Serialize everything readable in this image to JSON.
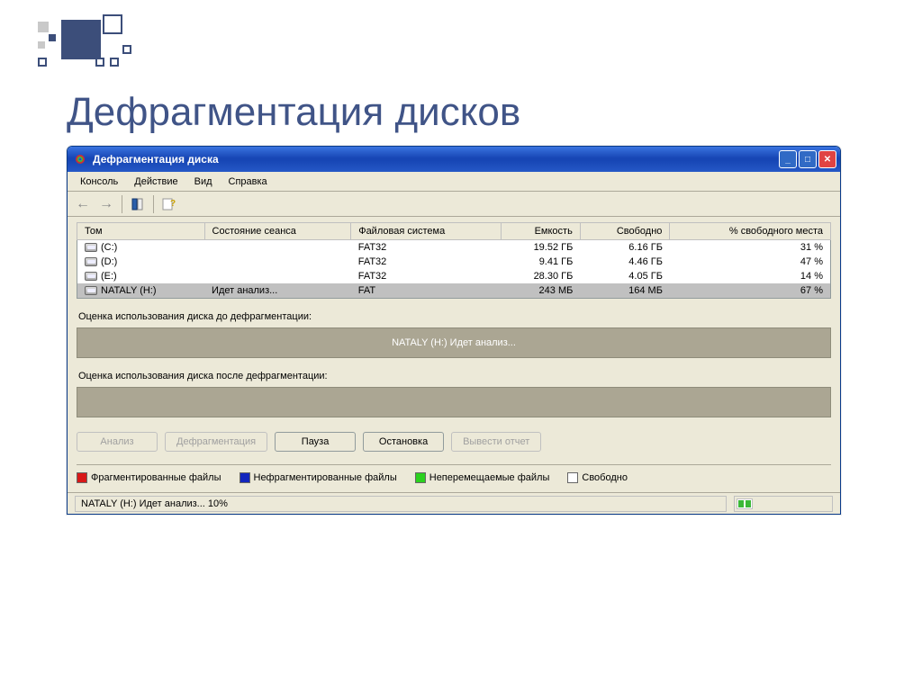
{
  "slide": {
    "title": "Дефрагментация дисков"
  },
  "window": {
    "title": "Дефрагментация диска",
    "menubar": [
      "Консоль",
      "Действие",
      "Вид",
      "Справка"
    ],
    "columns": {
      "volume": "Том",
      "session": "Состояние сеанса",
      "fs": "Файловая система",
      "capacity": "Емкость",
      "free": "Свободно",
      "freepct": "% свободного места"
    },
    "rows": [
      {
        "volume": "(C:)",
        "session": "",
        "fs": "FAT32",
        "capacity": "19.52 ГБ",
        "free": "6.16 ГБ",
        "freepct": "31 %"
      },
      {
        "volume": "(D:)",
        "session": "",
        "fs": "FAT32",
        "capacity": "9.41 ГБ",
        "free": "4.46 ГБ",
        "freepct": "47 %"
      },
      {
        "volume": "(E:)",
        "session": "",
        "fs": "FAT32",
        "capacity": "28.30 ГБ",
        "free": "4.05 ГБ",
        "freepct": "14 %"
      },
      {
        "volume": "NATALY (H:)",
        "session": "Идет анализ...",
        "fs": "FAT",
        "capacity": "243 МБ",
        "free": "164 МБ",
        "freepct": "67 %"
      }
    ],
    "before_label": "Оценка использования диска до дефрагментации:",
    "before_bar_text": "NATALY (H:) Идет анализ...",
    "after_label": "Оценка использования диска после дефрагментации:",
    "buttons": {
      "analyze": "Анализ",
      "defrag": "Дефрагментация",
      "pause": "Пауза",
      "stop": "Остановка",
      "report": "Вывести отчет"
    },
    "legend": {
      "fragmented": "Фрагментированные файлы",
      "contiguous": "Нефрагментированные файлы",
      "unmovable": "Неперемещаемые файлы",
      "free": "Свободно"
    },
    "status": "NATALY (H:) Идет анализ... 10%"
  }
}
